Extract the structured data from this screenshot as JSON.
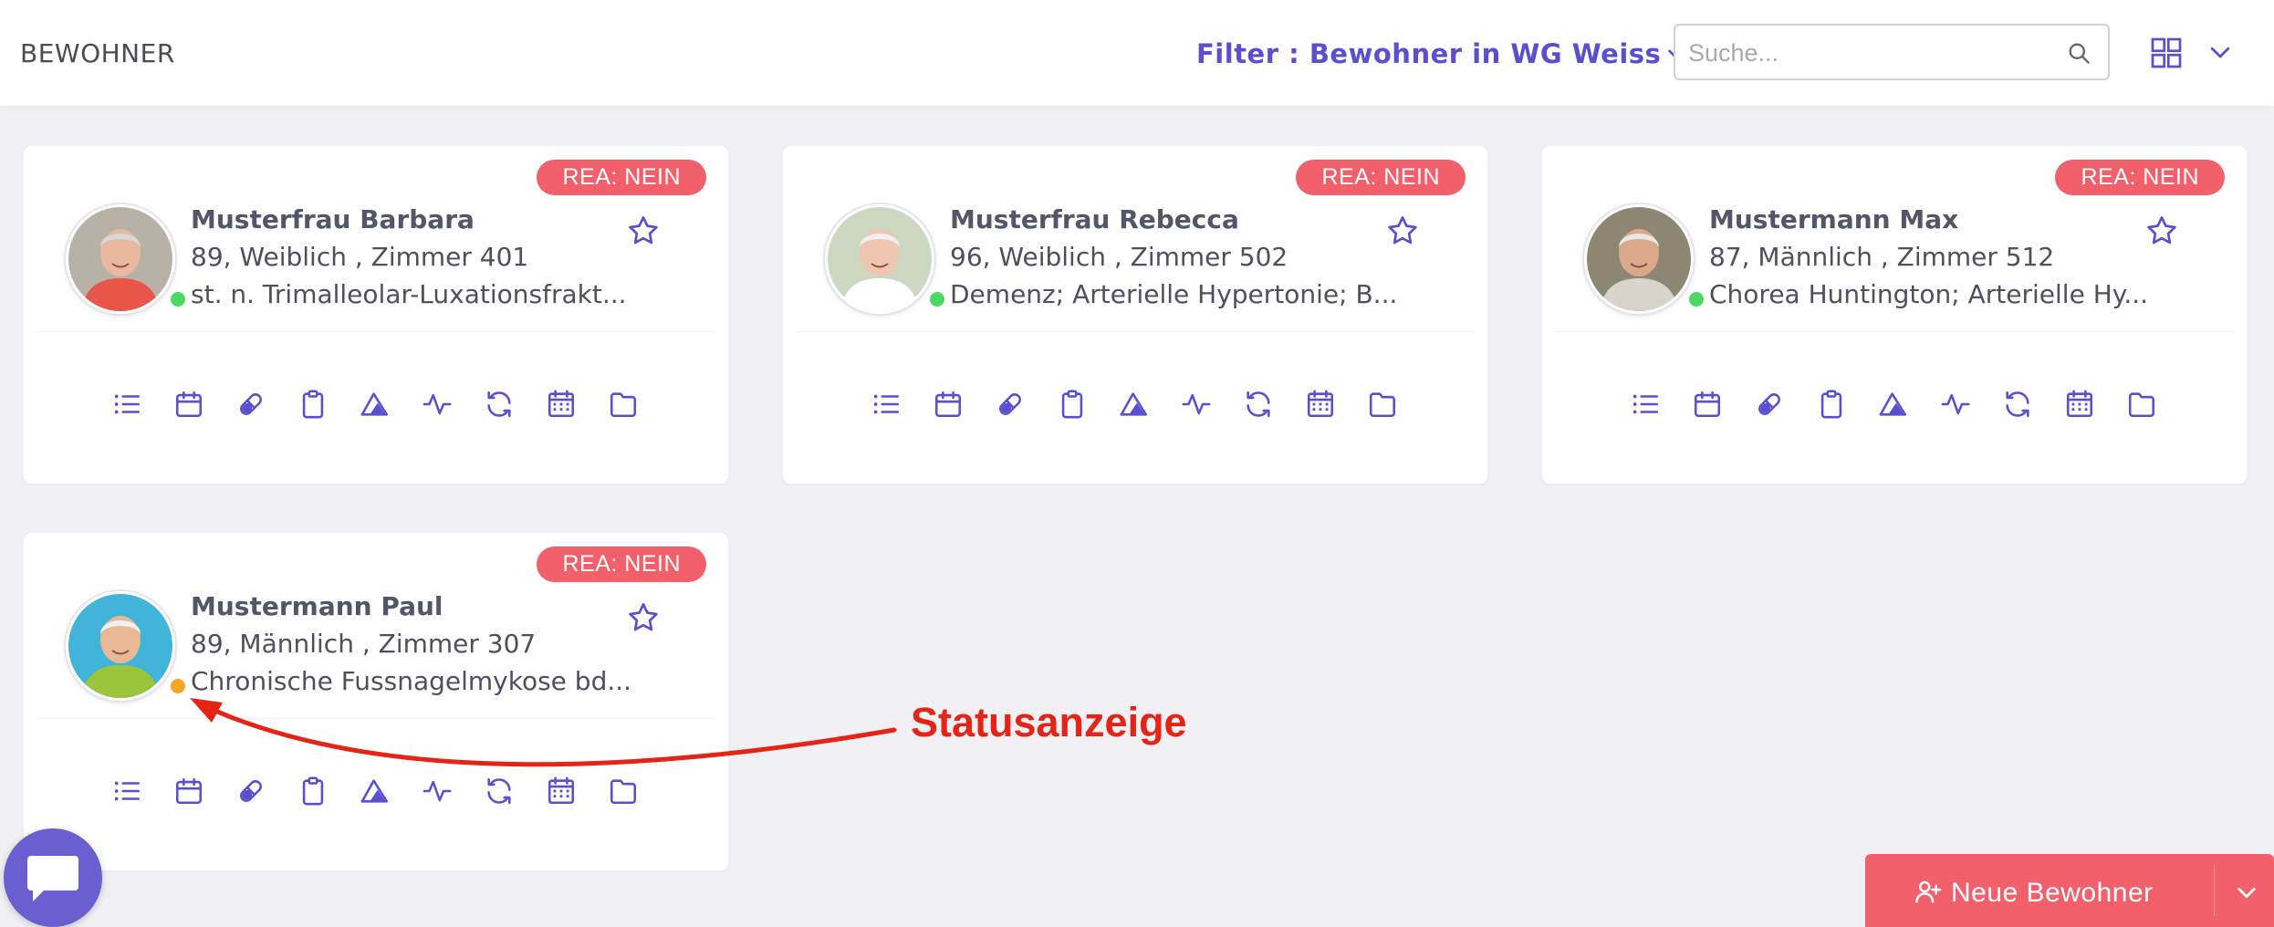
{
  "header": {
    "title": "BEWOHNER",
    "filter_label": "Filter : Bewohner in WG Weiss",
    "search_placeholder": "Suche..."
  },
  "colors": {
    "accent": "#5a4fcf",
    "badge": "#f2606c",
    "status_green": "#4cd964",
    "status_orange": "#f5a623",
    "callout": "#e52416"
  },
  "residents": [
    {
      "name": "Musterfrau Barbara",
      "info": "89, Weiblich , Zimmer 401",
      "diagnosis": "st. n. Trimalleolar-Luxationsfrakt...",
      "badge": "REA: NEIN",
      "status": "green"
    },
    {
      "name": "Musterfrau Rebecca",
      "info": "96, Weiblich , Zimmer 502",
      "diagnosis": "Demenz; Arterielle Hypertonie; B...",
      "badge": "REA: NEIN",
      "status": "green"
    },
    {
      "name": "Mustermann Max",
      "info": "87, Männlich , Zimmer 512",
      "diagnosis": "Chorea Huntington; Arterielle Hy...",
      "badge": "REA: NEIN",
      "status": "green"
    },
    {
      "name": "Mustermann Paul",
      "info": "89, Männlich , Zimmer 307",
      "diagnosis": "Chronische Fussnagelmykose bd...",
      "badge": "REA: NEIN",
      "status": "orange"
    }
  ],
  "card_actions": [
    "list-icon",
    "calendar-icon",
    "pill-icon",
    "clipboard-icon",
    "mountain-icon",
    "activity-icon",
    "refresh-icon",
    "schedule-icon",
    "folder-icon"
  ],
  "callout": {
    "label": "Statusanzeige"
  },
  "footer": {
    "new_button_label": "Neue Bewohner"
  }
}
